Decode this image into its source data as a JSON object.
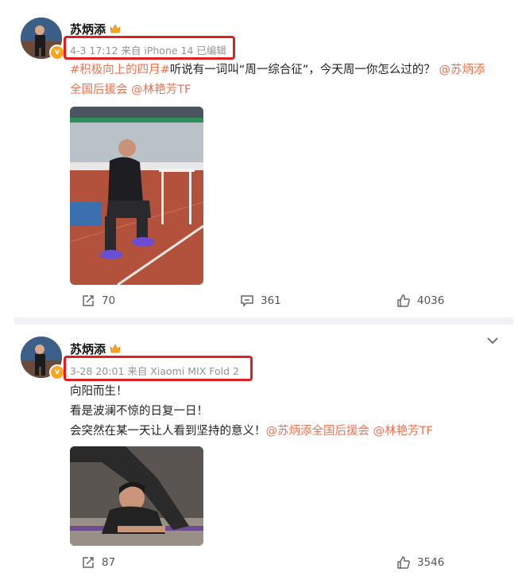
{
  "posts": [
    {
      "username": "苏炳添",
      "meta": "4-3 17:12 来自 iPhone 14 已编辑",
      "text": {
        "topic": "#积极向上的四月#",
        "body": "听说有一词叫“周一综合征”，今天周一你怎么过的？",
        "mention1": "@苏炳添",
        "mention1_rest": "全国后援会",
        "mention2": "@林艳芳TF"
      },
      "actions": {
        "repost": "70",
        "comment": "361",
        "like": "4036"
      }
    },
    {
      "username": "苏炳添",
      "meta": "3-28 20:01 来自 Xiaomi MIX Fold 2",
      "text": {
        "line1": "向阳而生！",
        "line2": "看是波澜不惊的日复一日！",
        "line3": "会突然在某一天让人看到坚持的意义！",
        "mention1": "@苏炳添全国后援会",
        "mention2": "@林艳芳TF"
      },
      "actions": {
        "repost": "87",
        "like": "3546"
      }
    }
  ],
  "colors": {
    "link": "#eb7350",
    "highlight_box": "#e02020",
    "badge": "#f6a623"
  },
  "icons": [
    "verified-badge-icon",
    "crown-icon",
    "repost-icon",
    "comment-icon",
    "like-icon",
    "chevron-down-icon"
  ]
}
